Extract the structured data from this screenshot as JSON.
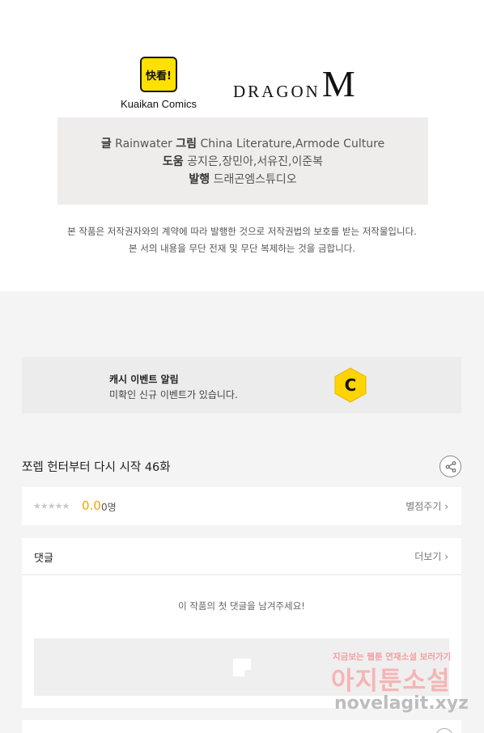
{
  "publishers": {
    "kuaikan_badge": "快看!",
    "kuaikan_name": "Kuaikan Comics",
    "dragon_text": "DRAGON",
    "dragon_m": "M"
  },
  "credits": {
    "writer_label": "글",
    "writer_value": "Rainwater",
    "art_label": "그림",
    "art_value": "China Literature,Armode Culture",
    "assist_label": "도움",
    "assist_value": "공지은,장민아,서유진,이준복",
    "publisher_label": "발행",
    "publisher_value": "드래곤엠스튜디오"
  },
  "copyright": {
    "line1": "본 작품은 저작권자와의 계약에 따라 발행한 것으로 저작권법의 보호를 받는 저작물입니다.",
    "line2": "본 서의 내용을 무단 전재 및 무단 복제하는 것을 금합니다."
  },
  "event": {
    "title": "캐시 이벤트 알림",
    "desc": "미확인 신규 이벤트가 있습니다.",
    "coin_letter": "C"
  },
  "episode": {
    "title": "쪼렙 헌터부터 다시 시작 46화"
  },
  "rating": {
    "stars": "★★★★★",
    "score": "0.0",
    "count": "0명",
    "rate_label": "별점주기 ›"
  },
  "comments": {
    "title": "댓글",
    "more_label": "더보기 ›",
    "empty_text": "이 작품의 첫 댓글을 남겨주세요!"
  },
  "watermark": {
    "top": "지금보는 웹툰 연재소설 보러가기",
    "mid": "아지툰소설",
    "bottom": "novelagit.xyz"
  },
  "colors": {
    "accent_yellow": "#ffe100",
    "score_orange": "#f0a500",
    "panel_gray": "#efedec"
  }
}
